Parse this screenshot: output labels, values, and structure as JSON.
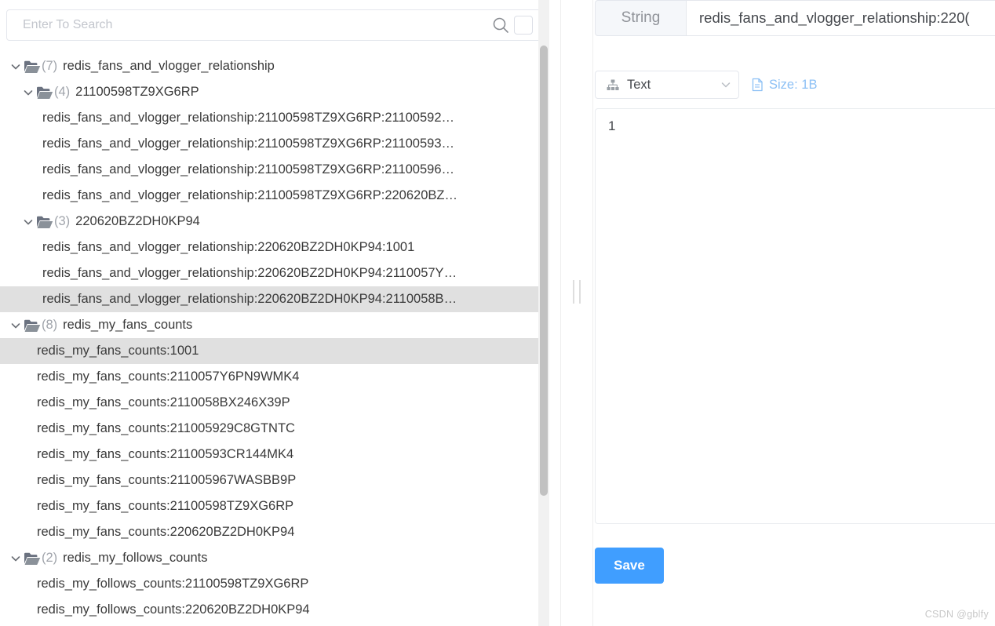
{
  "search": {
    "placeholder": "Enter To Search",
    "value": "",
    "search_icon": "search-icon",
    "toggle_icon": "square-checkbox-icon"
  },
  "tree": {
    "nodes": [
      {
        "level": 1,
        "kind": "folder",
        "count": "(7)",
        "label": "redis_fans_and_vlogger_relationship",
        "expanded": true,
        "selected": false
      },
      {
        "level": 2,
        "kind": "folder",
        "count": "(4)",
        "label": "21100598TZ9XG6RP",
        "expanded": true,
        "selected": false
      },
      {
        "level": 3,
        "kind": "leaf",
        "label": "redis_fans_and_vlogger_relationship:21100598TZ9XG6RP:21100592…",
        "selected": false
      },
      {
        "level": 3,
        "kind": "leaf",
        "label": "redis_fans_and_vlogger_relationship:21100598TZ9XG6RP:21100593…",
        "selected": false
      },
      {
        "level": 3,
        "kind": "leaf",
        "label": "redis_fans_and_vlogger_relationship:21100598TZ9XG6RP:21100596…",
        "selected": false
      },
      {
        "level": 3,
        "kind": "leaf",
        "label": "redis_fans_and_vlogger_relationship:21100598TZ9XG6RP:220620BZ…",
        "selected": false
      },
      {
        "level": 2,
        "kind": "folder",
        "count": "(3)",
        "label": "220620BZ2DH0KP94",
        "expanded": true,
        "selected": false
      },
      {
        "level": 3,
        "kind": "leaf",
        "label": "redis_fans_and_vlogger_relationship:220620BZ2DH0KP94:1001",
        "selected": false
      },
      {
        "level": 3,
        "kind": "leaf",
        "label": "redis_fans_and_vlogger_relationship:220620BZ2DH0KP94:2110057Y…",
        "selected": false
      },
      {
        "level": 3,
        "kind": "leaf",
        "label": "redis_fans_and_vlogger_relationship:220620BZ2DH0KP94:2110058B…",
        "selected": true
      },
      {
        "level": 1,
        "kind": "folder",
        "count": "(8)",
        "label": "redis_my_fans_counts",
        "expanded": true,
        "selected": false
      },
      {
        "level": 2,
        "kind": "leaf",
        "label": "redis_my_fans_counts:1001",
        "selected": true
      },
      {
        "level": 2,
        "kind": "leaf",
        "label": "redis_my_fans_counts:2110057Y6PN9WMK4",
        "selected": false
      },
      {
        "level": 2,
        "kind": "leaf",
        "label": "redis_my_fans_counts:2110058BX246X39P",
        "selected": false
      },
      {
        "level": 2,
        "kind": "leaf",
        "label": "redis_my_fans_counts:211005929C8GTNTC",
        "selected": false
      },
      {
        "level": 2,
        "kind": "leaf",
        "label": "redis_my_fans_counts:21100593CR144MK4",
        "selected": false
      },
      {
        "level": 2,
        "kind": "leaf",
        "label": "redis_my_fans_counts:211005967WASBB9P",
        "selected": false
      },
      {
        "level": 2,
        "kind": "leaf",
        "label": "redis_my_fans_counts:21100598TZ9XG6RP",
        "selected": false
      },
      {
        "level": 2,
        "kind": "leaf",
        "label": "redis_my_fans_counts:220620BZ2DH0KP94",
        "selected": false
      },
      {
        "level": 1,
        "kind": "folder",
        "count": "(2)",
        "label": "redis_my_follows_counts",
        "expanded": true,
        "selected": false
      },
      {
        "level": 2,
        "kind": "leaf",
        "label": "redis_my_follows_counts:21100598TZ9XG6RP",
        "selected": false
      },
      {
        "level": 2,
        "kind": "leaf",
        "label": "redis_my_follows_counts:220620BZ2DH0KP94",
        "selected": false
      }
    ]
  },
  "detail": {
    "type_badge": "String",
    "key_value": "redis_fans_and_vlogger_relationship:220(",
    "key_chevron_icon": "chevron-down-icon",
    "view_mode": "Text",
    "view_mode_icon": "sitemap-icon",
    "view_mode_chevron_icon": "chevron-down-icon",
    "size_label": "Size: 1B",
    "size_icon": "document-icon",
    "value": "1",
    "save_label": "Save"
  },
  "watermark": "CSDN @gblfy",
  "colors": {
    "accent": "#409eff",
    "selected_row": "#e0e0e0",
    "size_text": "#8cc0f5",
    "muted": "#909399"
  }
}
